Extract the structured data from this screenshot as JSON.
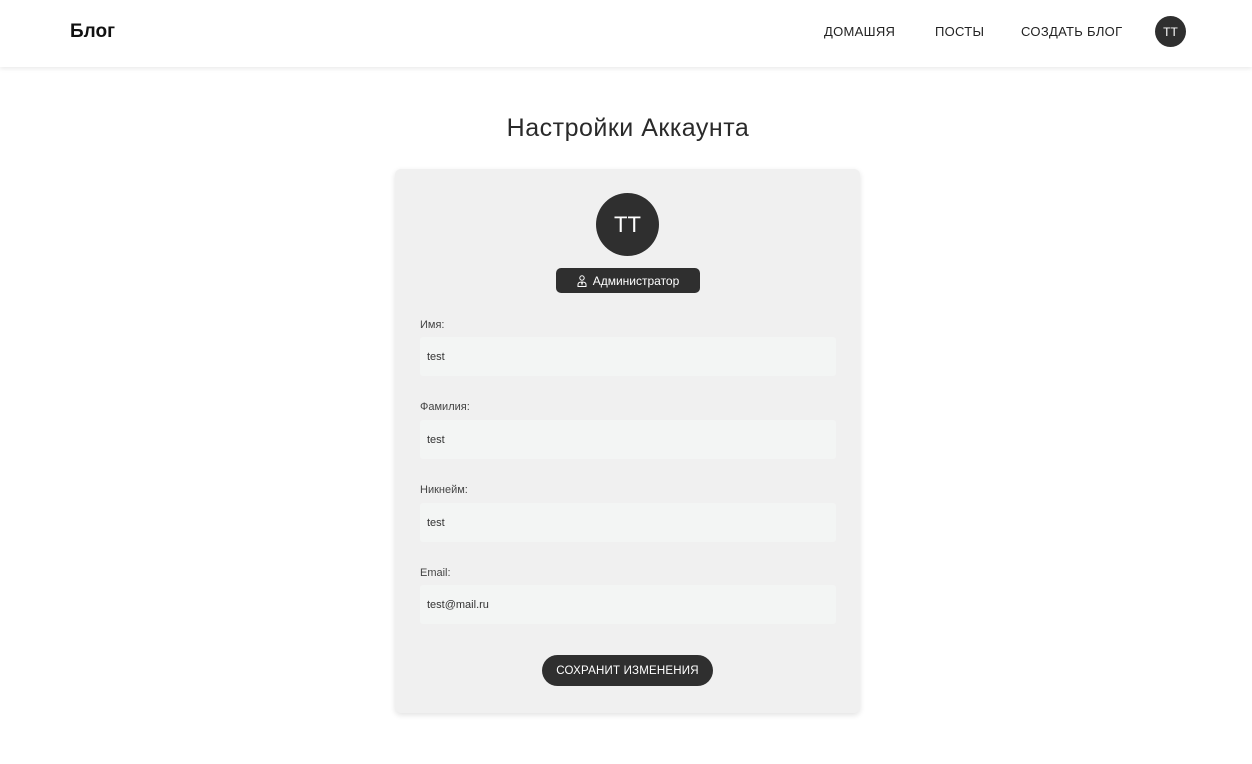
{
  "navbar": {
    "brand": "Блог",
    "links": {
      "home": "ДОМАШЯЯ",
      "posts": "ПОСТЫ",
      "create_blog": "СОЗДАТЬ БЛОГ"
    },
    "avatar_initials": "ТТ"
  },
  "page": {
    "title": "Настройки Аккаунта"
  },
  "profile": {
    "avatar_initials": "ТТ",
    "role": "Администратор",
    "role_icon": "user-tie-icon"
  },
  "form": {
    "first_name": {
      "label": "Имя:",
      "value": "test"
    },
    "last_name": {
      "label": "Фамилия:",
      "value": "test"
    },
    "nickname": {
      "label": "Никнейм:",
      "value": "test"
    },
    "email": {
      "label": "Email:",
      "value": "test@mail.ru"
    },
    "save_label": "СОХРАНИТ ИЗМЕНЕНИЯ"
  },
  "colors": {
    "accent_dark": "#2f2f2f",
    "card_bg": "#f0f0f0",
    "input_bg": "#f3f5f4"
  }
}
